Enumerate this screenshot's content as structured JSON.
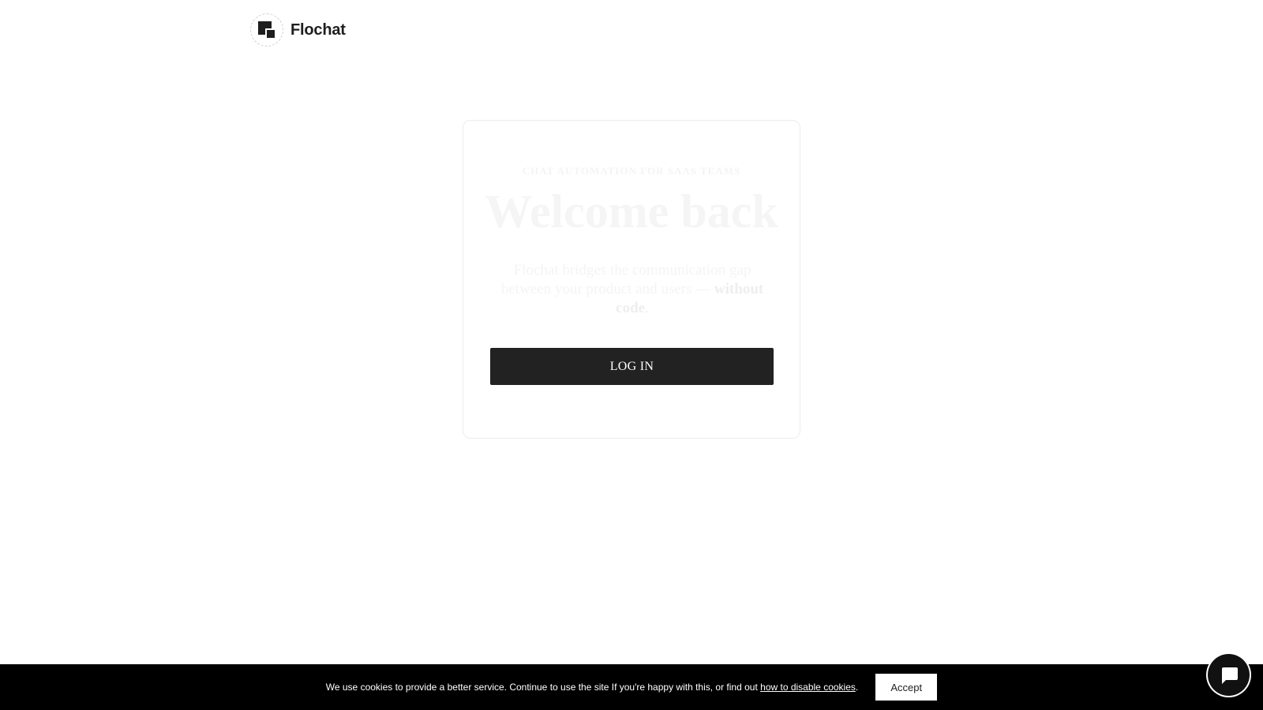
{
  "brand": {
    "name": "Flochat",
    "logo_icon": "flochat-logo-icon"
  },
  "card": {
    "kicker": "CHAT AUTOMATION FOR SAAS TEAMS",
    "headline": "Welcome back",
    "description_prefix": "Flochat bridges the communication gap between your product and users — ",
    "description_bold": "without code",
    "description_suffix": ".",
    "login_label": "LOG IN"
  },
  "cookie_banner": {
    "text": "We use cookies to provide a better service. Continue to use the site If you're happy with this, or find out ",
    "link_text": "how to disable cookies",
    "text_end": ".",
    "accept_label": "Accept"
  },
  "chat_widget": {
    "icon": "chat-bubble-icon"
  },
  "colors": {
    "primary_button": "#222222",
    "cookie_bar": "#000000",
    "background": "#ffffff"
  }
}
